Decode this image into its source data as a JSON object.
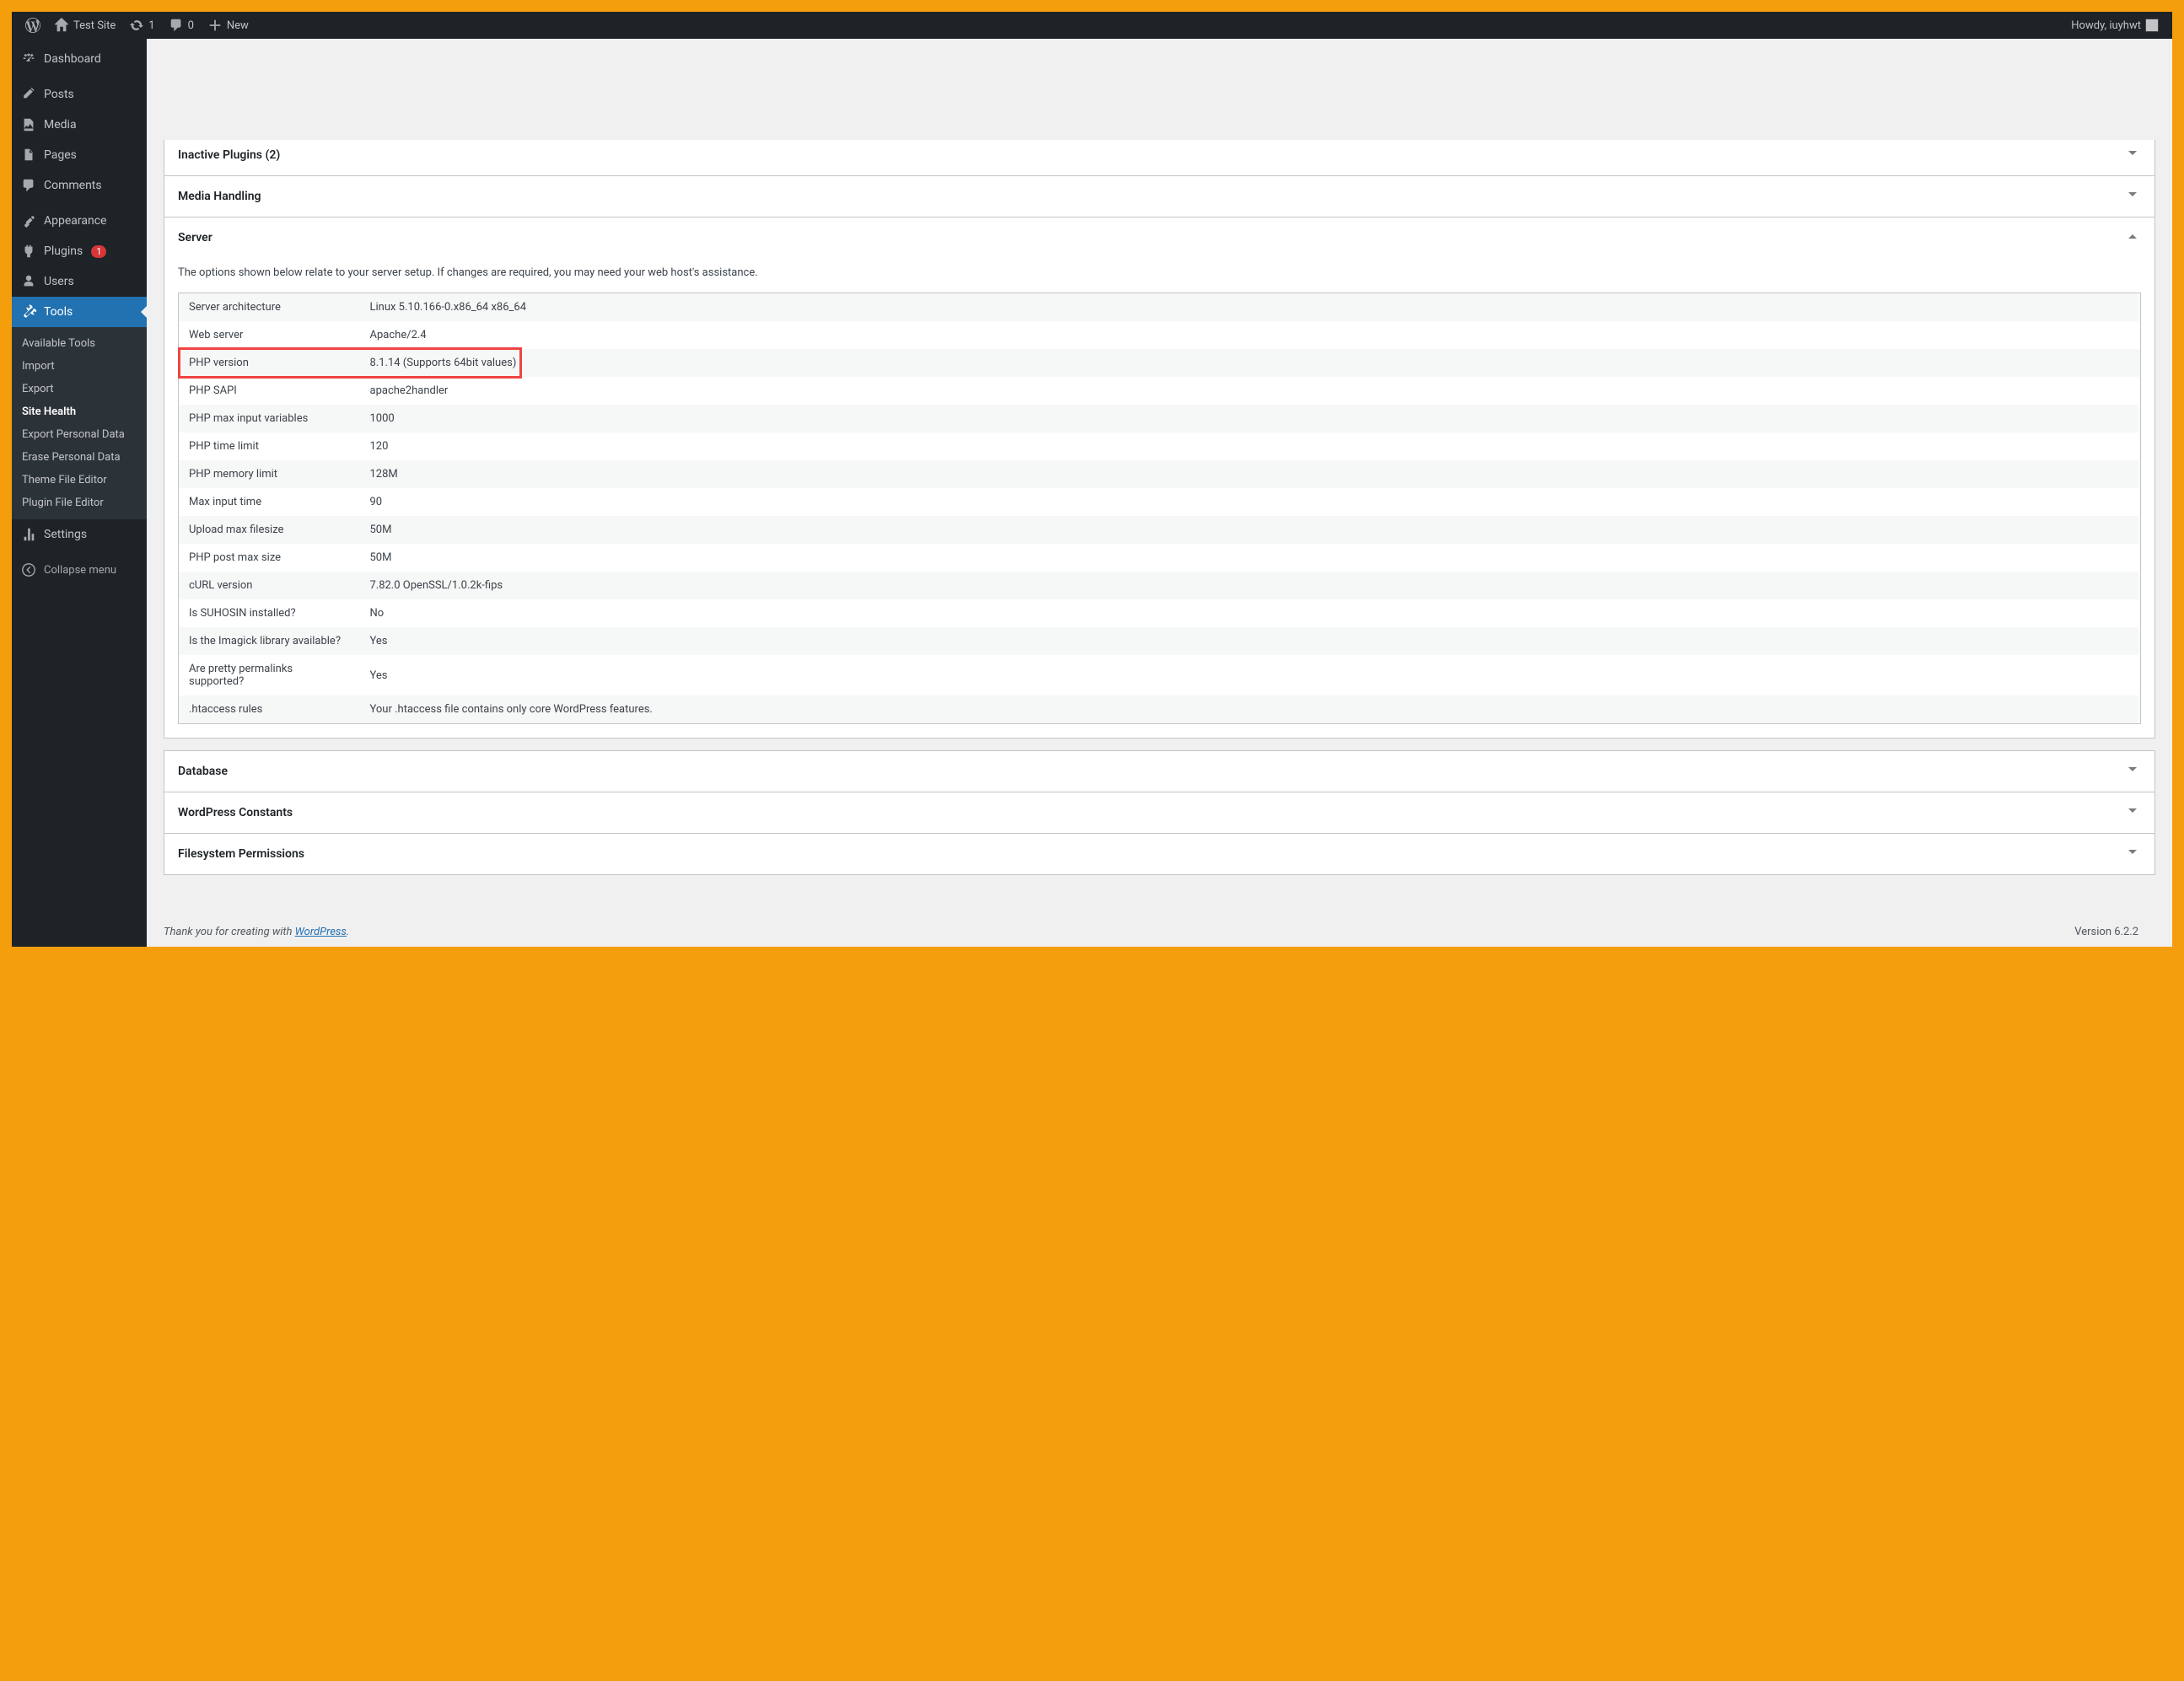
{
  "adminbar": {
    "site_title": "Test Site",
    "updates_count": "1",
    "comments_count": "0",
    "new_label": "New",
    "howdy_prefix": "Howdy, ",
    "user_name": "iuyhwt"
  },
  "sidebar": {
    "items": [
      {
        "label": "Dashboard"
      },
      {
        "label": "Posts"
      },
      {
        "label": "Media"
      },
      {
        "label": "Pages"
      },
      {
        "label": "Comments"
      },
      {
        "label": "Appearance"
      },
      {
        "label": "Plugins",
        "badge": "1"
      },
      {
        "label": "Users"
      },
      {
        "label": "Tools"
      },
      {
        "label": "Settings"
      }
    ],
    "submenu_tools": [
      {
        "label": "Available Tools"
      },
      {
        "label": "Import"
      },
      {
        "label": "Export"
      },
      {
        "label": "Site Health"
      },
      {
        "label": "Export Personal Data"
      },
      {
        "label": "Erase Personal Data"
      },
      {
        "label": "Theme File Editor"
      },
      {
        "label": "Plugin File Editor"
      }
    ],
    "collapse_label": "Collapse menu"
  },
  "sections": {
    "inactive_plugins": "Inactive Plugins (2)",
    "media_handling": "Media Handling",
    "server": "Server",
    "database": "Database",
    "wp_constants": "WordPress Constants",
    "fs_permissions": "Filesystem Permissions",
    "server_desc": "The options shown below relate to your server setup. If changes are required, you may need your web host's assistance."
  },
  "server_table": [
    {
      "k": "Server architecture",
      "v": "Linux 5.10.166-0.x86_64 x86_64"
    },
    {
      "k": "Web server",
      "v": "Apache/2.4"
    },
    {
      "k": "PHP version",
      "v": "8.1.14 (Supports 64bit values)"
    },
    {
      "k": "PHP SAPI",
      "v": "apache2handler"
    },
    {
      "k": "PHP max input variables",
      "v": "1000"
    },
    {
      "k": "PHP time limit",
      "v": "120"
    },
    {
      "k": "PHP memory limit",
      "v": "128M"
    },
    {
      "k": "Max input time",
      "v": "90"
    },
    {
      "k": "Upload max filesize",
      "v": "50M"
    },
    {
      "k": "PHP post max size",
      "v": "50M"
    },
    {
      "k": "cURL version",
      "v": "7.82.0 OpenSSL/1.0.2k-fips"
    },
    {
      "k": "Is SUHOSIN installed?",
      "v": "No"
    },
    {
      "k": "Is the Imagick library available?",
      "v": "Yes"
    },
    {
      "k": "Are pretty permalinks supported?",
      "v": "Yes"
    },
    {
      "k": ".htaccess rules",
      "v": "Your .htaccess file contains only core WordPress features."
    }
  ],
  "footer": {
    "thanks_prefix": "Thank you for creating with ",
    "wp_link": "WordPress",
    "version": "Version 6.2.2"
  }
}
